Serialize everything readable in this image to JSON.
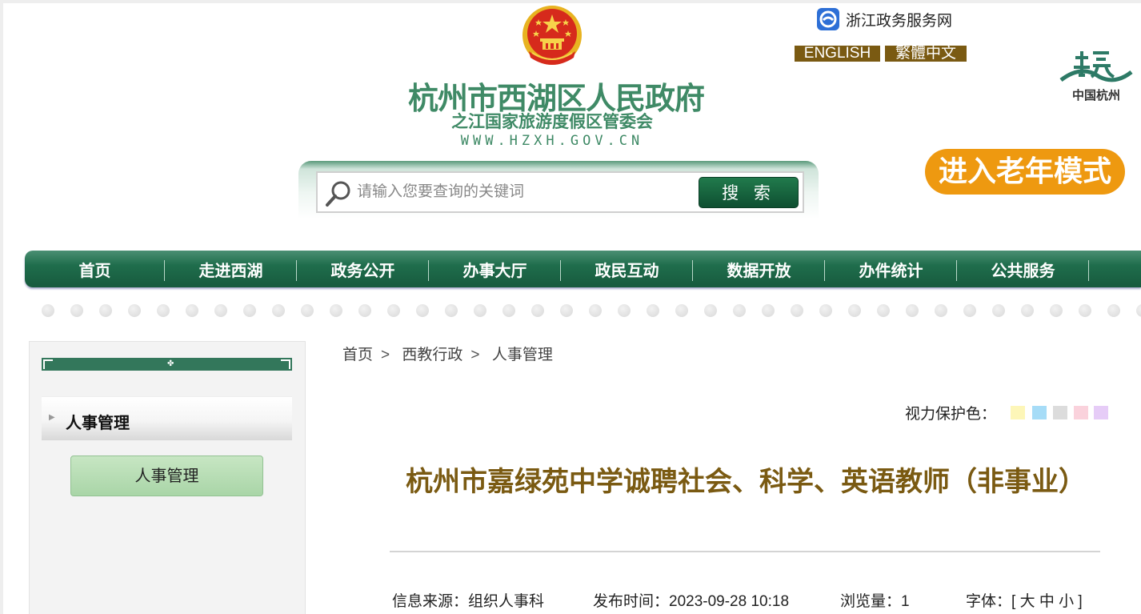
{
  "header": {
    "title": "杭州市西湖区人民政府",
    "subtitle": "之江国家旅游度假区管委会",
    "url": "WWW.HZXH.GOV.CN",
    "zjzw_label": "浙江政务服务网",
    "lang_english": "ENGLISH",
    "lang_traditional": "繁體中文",
    "hz_logo_text": "中国杭州",
    "elder_mode": "进入老年模式"
  },
  "search": {
    "placeholder": "请输入您要查询的关键词",
    "button": "搜 索"
  },
  "nav": {
    "items": [
      "首页",
      "走进西湖",
      "政务公开",
      "办事大厅",
      "政民互动",
      "数据开放",
      "办件统计",
      "公共服务"
    ]
  },
  "sidebar": {
    "heading": "人事管理",
    "link": "人事管理"
  },
  "breadcrumb": {
    "items": [
      "首页",
      "西教行政",
      "人事管理"
    ],
    "separator": ">"
  },
  "eye_protection": {
    "label": "视力保护色：",
    "colors": [
      "#fdf6b8",
      "#a6dcf7",
      "#dcdcdc",
      "#fad2dc",
      "#e6ccf7"
    ]
  },
  "article": {
    "title": "杭州市嘉绿苑中学诚聘社会、科学、英语教师（非事业）",
    "source": "信息来源：组织人事科",
    "publish_time": "发布时间：2023-09-28 10:18",
    "views": "浏览量：1",
    "font_label": "字体：",
    "font_sizes": "[ 大 中 小 ]"
  },
  "colors": {
    "brand_green": "#3f8a66",
    "nav_green": "#1f6d4c",
    "title_brown": "#7a5a12",
    "elder_orange": "#ee9910"
  }
}
